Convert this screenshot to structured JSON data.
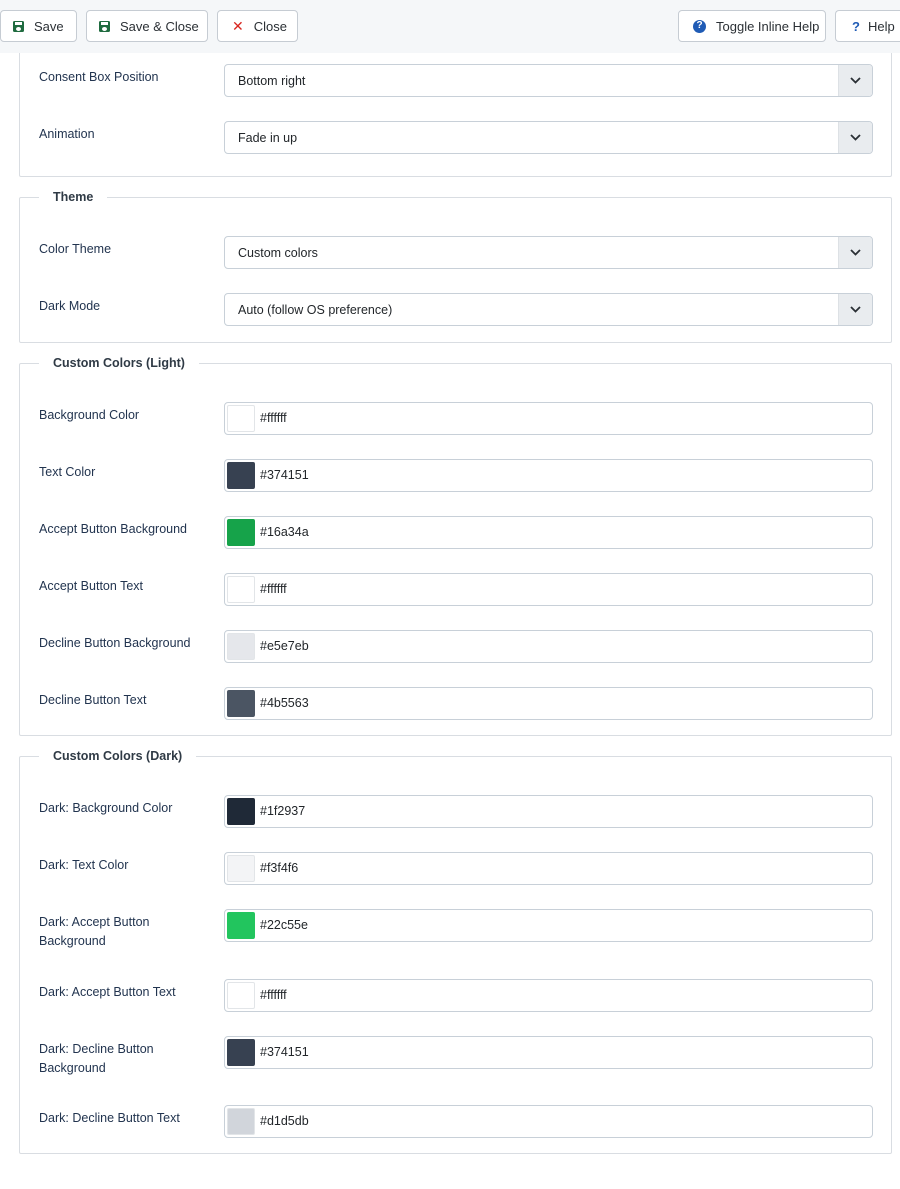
{
  "toolbar": {
    "save_label": "Save",
    "save_close_label": "Save & Close",
    "close_label": "Close",
    "toggle_help_label": "Toggle Inline Help",
    "help_label": "Help",
    "icons": {
      "save": "floppy-disk-icon",
      "save_close": "floppy-disk-icon",
      "close": "close-x-icon",
      "toggle_help": "question-circle-icon",
      "help": "question-icon"
    },
    "colors": {
      "save_icon": "#1f6b3f",
      "close_icon": "#d8261f",
      "help_icon": "#1f5bb5"
    }
  },
  "layout_section": {
    "fields": [
      {
        "label": "Consent Box Position",
        "value": "Bottom right"
      },
      {
        "label": "Animation",
        "value": "Fade in up"
      }
    ]
  },
  "theme_section": {
    "legend": "Theme",
    "fields": [
      {
        "label": "Color Theme",
        "value": "Custom colors"
      },
      {
        "label": "Dark Mode",
        "value": "Auto (follow OS preference)"
      }
    ]
  },
  "light_section": {
    "legend": "Custom Colors (Light)",
    "fields": [
      {
        "label": "Background Color",
        "value": "#ffffff",
        "swatch": "#ffffff"
      },
      {
        "label": "Text Color",
        "value": "#374151",
        "swatch": "#374151"
      },
      {
        "label": "Accept Button Background",
        "value": "#16a34a",
        "swatch": "#16a34a"
      },
      {
        "label": "Accept Button Text",
        "value": "#ffffff",
        "swatch": "#ffffff"
      },
      {
        "label": "Decline Button Background",
        "value": "#e5e7eb",
        "swatch": "#e5e7eb"
      },
      {
        "label": "Decline Button Text",
        "value": "#4b5563",
        "swatch": "#4b5563"
      }
    ]
  },
  "dark_section": {
    "legend": "Custom Colors (Dark)",
    "fields": [
      {
        "label": "Dark: Background Color",
        "value": "#1f2937",
        "swatch": "#1f2937"
      },
      {
        "label": "Dark: Text Color",
        "value": "#f3f4f6",
        "swatch": "#f3f4f6"
      },
      {
        "label": "Dark: Accept Button Background",
        "value": "#22c55e",
        "swatch": "#22c55e"
      },
      {
        "label": "Dark: Accept Button Text",
        "value": "#ffffff",
        "swatch": "#ffffff"
      },
      {
        "label": "Dark: Decline Button Background",
        "value": "#374151",
        "swatch": "#374151"
      },
      {
        "label": "Dark: Decline Button Text",
        "value": "#d1d5db",
        "swatch": "#d1d5db"
      }
    ]
  }
}
